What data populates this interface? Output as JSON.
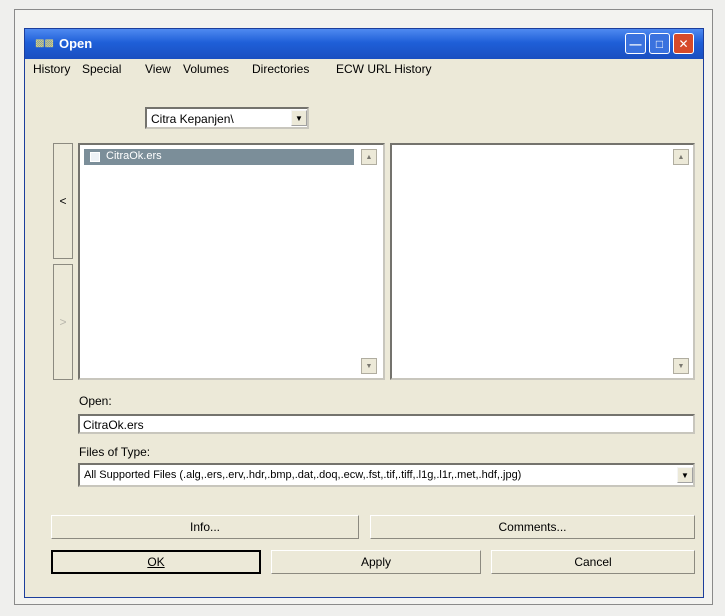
{
  "window": {
    "title": "Open"
  },
  "menu": [
    {
      "label": "History"
    },
    {
      "label": "Special"
    },
    {
      "label": "View"
    },
    {
      "label": "Volumes"
    },
    {
      "label": "Directories"
    },
    {
      "label": "ECW URL History"
    }
  ],
  "directory": {
    "selected": "Citra Kepanjen\\"
  },
  "nav": {
    "back": "<",
    "forward": ">"
  },
  "files": [
    {
      "name": "CitraOk.ers",
      "selected": true
    }
  ],
  "open": {
    "label": "Open:",
    "value": "CitraOk.ers"
  },
  "file_type": {
    "label": "Files of Type:",
    "selected": "All Supported Files (.alg,.ers,.erv,.hdr,.bmp,.dat,.doq,.ecw,.fst,.tif,.tiff,.l1g,.l1r,.met,.hdf,.jpg)"
  },
  "buttons": {
    "info": "Info...",
    "comments": "Comments...",
    "ok": "OK",
    "apply": "Apply",
    "cancel": "Cancel"
  },
  "colors": {
    "title_bar": "#1f5fd8",
    "selection": "#7b8e99",
    "dialog_bg": "#ece9d8"
  }
}
